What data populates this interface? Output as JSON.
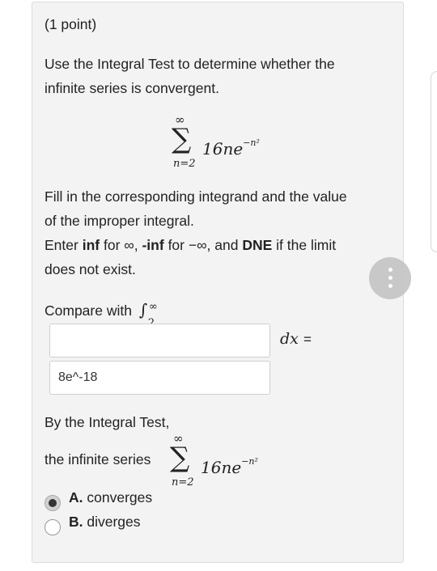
{
  "problem": {
    "points": "(1 point)",
    "intro_line1": "Use the Integral Test to determine whether the",
    "intro_line2": "infinite series is convergent.",
    "sum_upper": "∞",
    "sum_term": "16ne",
    "sum_exponent": "−n²",
    "sum_lower": "n=2",
    "instr_line1": "Fill in the corresponding integrand and the value",
    "instr_line2": "of the improper integral.",
    "enter_text": "Enter",
    "inf_bold": "inf",
    "for_text1": "for ∞,",
    "neg_inf_bold": "-inf",
    "for_text2": "for −∞, and",
    "dne_bold": "DNE",
    "if_text": "if the limit",
    "instr_line4": "does not exist.",
    "compare_label": "Compare with",
    "integral_lower": "2",
    "integral_upper": "∞",
    "dx_label": "dx",
    "equals": "=",
    "integrand_value": "",
    "integral_value": "8e^-18",
    "test_label": "By the Integral Test,",
    "series_label": "the infinite series",
    "options": [
      {
        "letter": "A.",
        "text": "converges",
        "selected": true
      },
      {
        "letter": "B.",
        "text": "diverges",
        "selected": false
      }
    ]
  },
  "fab": {
    "icon": "more-vertical-icon"
  }
}
